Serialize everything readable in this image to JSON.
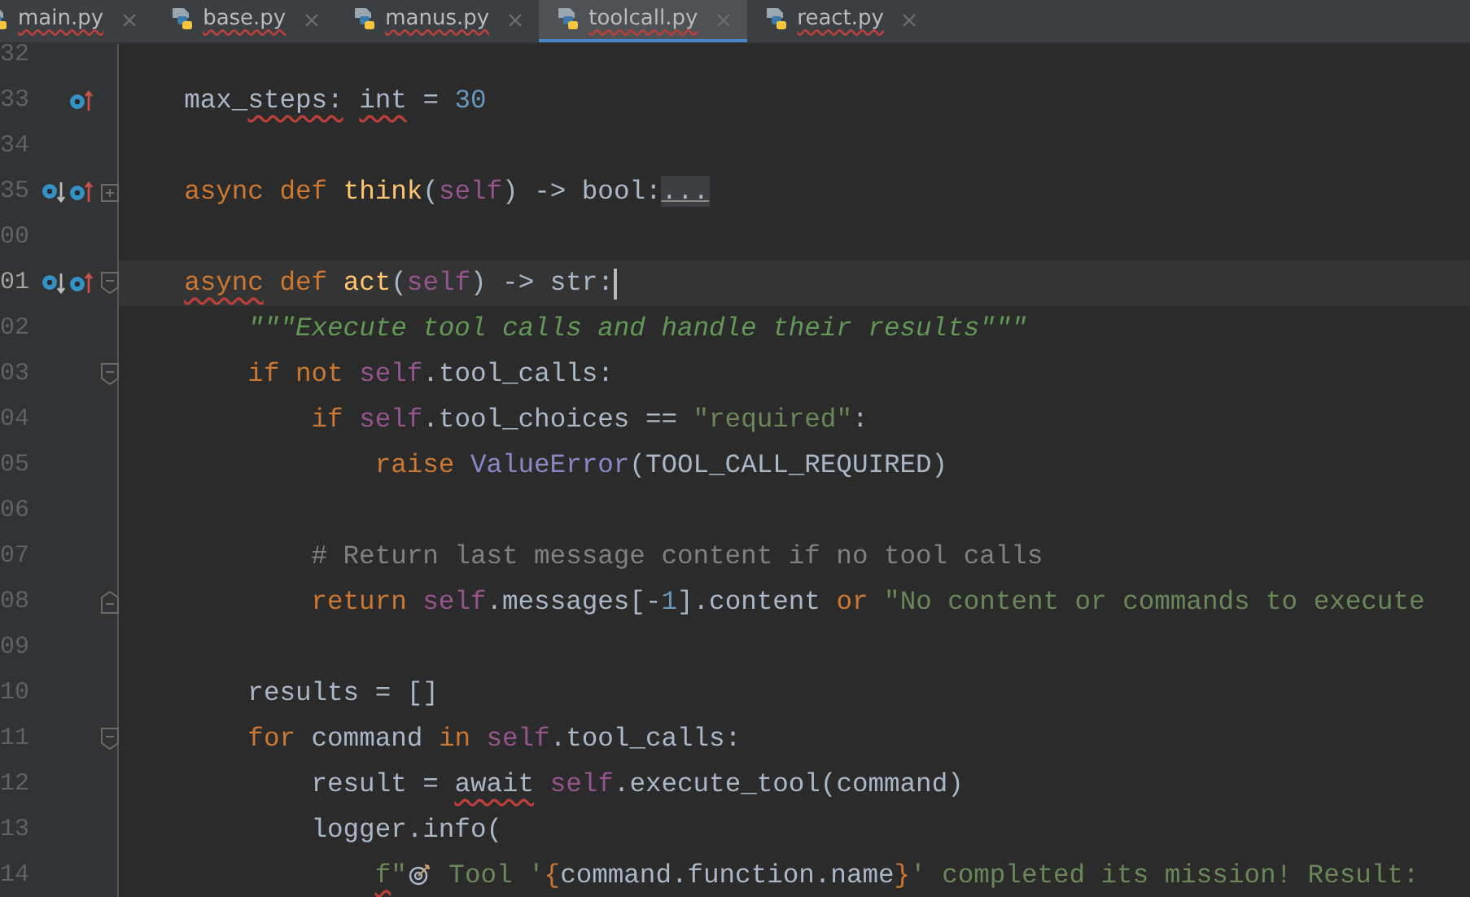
{
  "tabs": [
    {
      "label": "main.py",
      "selected": false,
      "spell_warning": true
    },
    {
      "label": "base.py",
      "selected": false,
      "spell_warning": true
    },
    {
      "label": "manus.py",
      "selected": false,
      "spell_warning": true
    },
    {
      "label": "toolcall.py",
      "selected": true,
      "spell_warning": true
    },
    {
      "label": "react.py",
      "selected": false,
      "spell_warning": true
    }
  ],
  "lines": [
    {
      "number": "32"
    },
    {
      "number": "33",
      "markers": [
        {
          "kind": "overrides"
        }
      ],
      "tokens": [
        {
          "text": "    max_",
          "kind": "plain"
        },
        {
          "text": "steps:",
          "kind": "typo"
        },
        {
          "text": " int",
          "kind": "typo"
        },
        {
          "text": " = ",
          "kind": "plain"
        },
        {
          "text": "30",
          "kind": "number"
        }
      ]
    },
    {
      "number": "34"
    },
    {
      "number": "35",
      "markers": [
        {
          "kind": "implemented"
        },
        {
          "kind": "overrides"
        }
      ],
      "fold": {
        "kind": "collapsed"
      },
      "tokens": [
        {
          "text": "    async def ",
          "kind": "keyword"
        },
        {
          "text": "think",
          "kind": "function"
        },
        {
          "text": "(",
          "kind": "plain"
        },
        {
          "text": "self",
          "kind": "self"
        },
        {
          "text": ") -> bool:",
          "kind": "plain"
        },
        {
          "text": "...",
          "kind": "folded"
        }
      ]
    },
    {
      "number": "00"
    },
    {
      "number": "01",
      "current": true,
      "markers": [
        {
          "kind": "implemented"
        },
        {
          "kind": "overrides"
        }
      ],
      "fold": {
        "kind": "start"
      },
      "tokens": [
        {
          "text": "    async",
          "kind": "keywordtypo"
        },
        {
          "text": " def ",
          "kind": "keyword"
        },
        {
          "text": "act",
          "kind": "function"
        },
        {
          "text": "(",
          "kind": "plain"
        },
        {
          "text": "self",
          "kind": "self"
        },
        {
          "text": ") -> str:",
          "kind": "plain"
        }
      ]
    },
    {
      "number": "02",
      "tokens": [
        {
          "text": "        \"\"\"Execute tool calls and handle their results\"\"\"",
          "kind": "docstring"
        }
      ]
    },
    {
      "number": "03",
      "fold": {
        "kind": "start"
      },
      "tokens": [
        {
          "text": "        if not ",
          "kind": "keyword"
        },
        {
          "text": "self",
          "kind": "self"
        },
        {
          "text": ".tool_calls:",
          "kind": "plain"
        }
      ]
    },
    {
      "number": "04",
      "tokens": [
        {
          "text": "            if ",
          "kind": "keyword"
        },
        {
          "text": "self",
          "kind": "self"
        },
        {
          "text": ".tool_choices == ",
          "kind": "plain"
        },
        {
          "text": "\"required\"",
          "kind": "string"
        },
        {
          "text": ":",
          "kind": "plain"
        }
      ]
    },
    {
      "number": "05",
      "tokens": [
        {
          "text": "                raise ",
          "kind": "keyword"
        },
        {
          "text": "ValueError",
          "kind": "builtin"
        },
        {
          "text": "(TOOL_CALL_REQUIRED)",
          "kind": "plain"
        }
      ]
    },
    {
      "number": "06"
    },
    {
      "number": "07",
      "tokens": [
        {
          "text": "            # Return last message content if no tool calls",
          "kind": "comment"
        }
      ]
    },
    {
      "number": "08",
      "fold": {
        "kind": "end"
      },
      "tokens": [
        {
          "text": "            return ",
          "kind": "keyword"
        },
        {
          "text": "self",
          "kind": "self"
        },
        {
          "text": ".messages[-",
          "kind": "plain"
        },
        {
          "text": "1",
          "kind": "number"
        },
        {
          "text": "].content ",
          "kind": "plain"
        },
        {
          "text": "or ",
          "kind": "keyword"
        },
        {
          "text": "\"No content or commands to execute",
          "kind": "string"
        }
      ]
    },
    {
      "number": "09"
    },
    {
      "number": "10",
      "tokens": [
        {
          "text": "        results = []",
          "kind": "plain"
        }
      ]
    },
    {
      "number": "11",
      "fold": {
        "kind": "start"
      },
      "tokens": [
        {
          "text": "        for ",
          "kind": "keyword"
        },
        {
          "text": "command ",
          "kind": "plain"
        },
        {
          "text": "in ",
          "kind": "keyword"
        },
        {
          "text": "self",
          "kind": "self"
        },
        {
          "text": ".tool_calls:",
          "kind": "plain"
        }
      ]
    },
    {
      "number": "12",
      "tokens": [
        {
          "text": "            result = ",
          "kind": "plain"
        },
        {
          "text": "await",
          "kind": "typo"
        },
        {
          "text": " self",
          "kind": "self"
        },
        {
          "text": ".execute_tool(command)",
          "kind": "plain"
        }
      ]
    },
    {
      "number": "13",
      "tokens": [
        {
          "text": "            logger.info(",
          "kind": "plain"
        }
      ]
    },
    {
      "number": "14",
      "tokens": [
        {
          "text": "                f",
          "kind": "stringtypo"
        },
        {
          "text": "\"",
          "kind": "string"
        },
        {
          "kind": "target"
        },
        {
          "text": " Tool '",
          "kind": "string"
        },
        {
          "text": "{",
          "kind": "keyword"
        },
        {
          "text": "command.function.name",
          "kind": "plain"
        },
        {
          "text": "}",
          "kind": "keyword"
        },
        {
          "text": "' completed its mission! Result:",
          "kind": "string"
        }
      ]
    }
  ]
}
